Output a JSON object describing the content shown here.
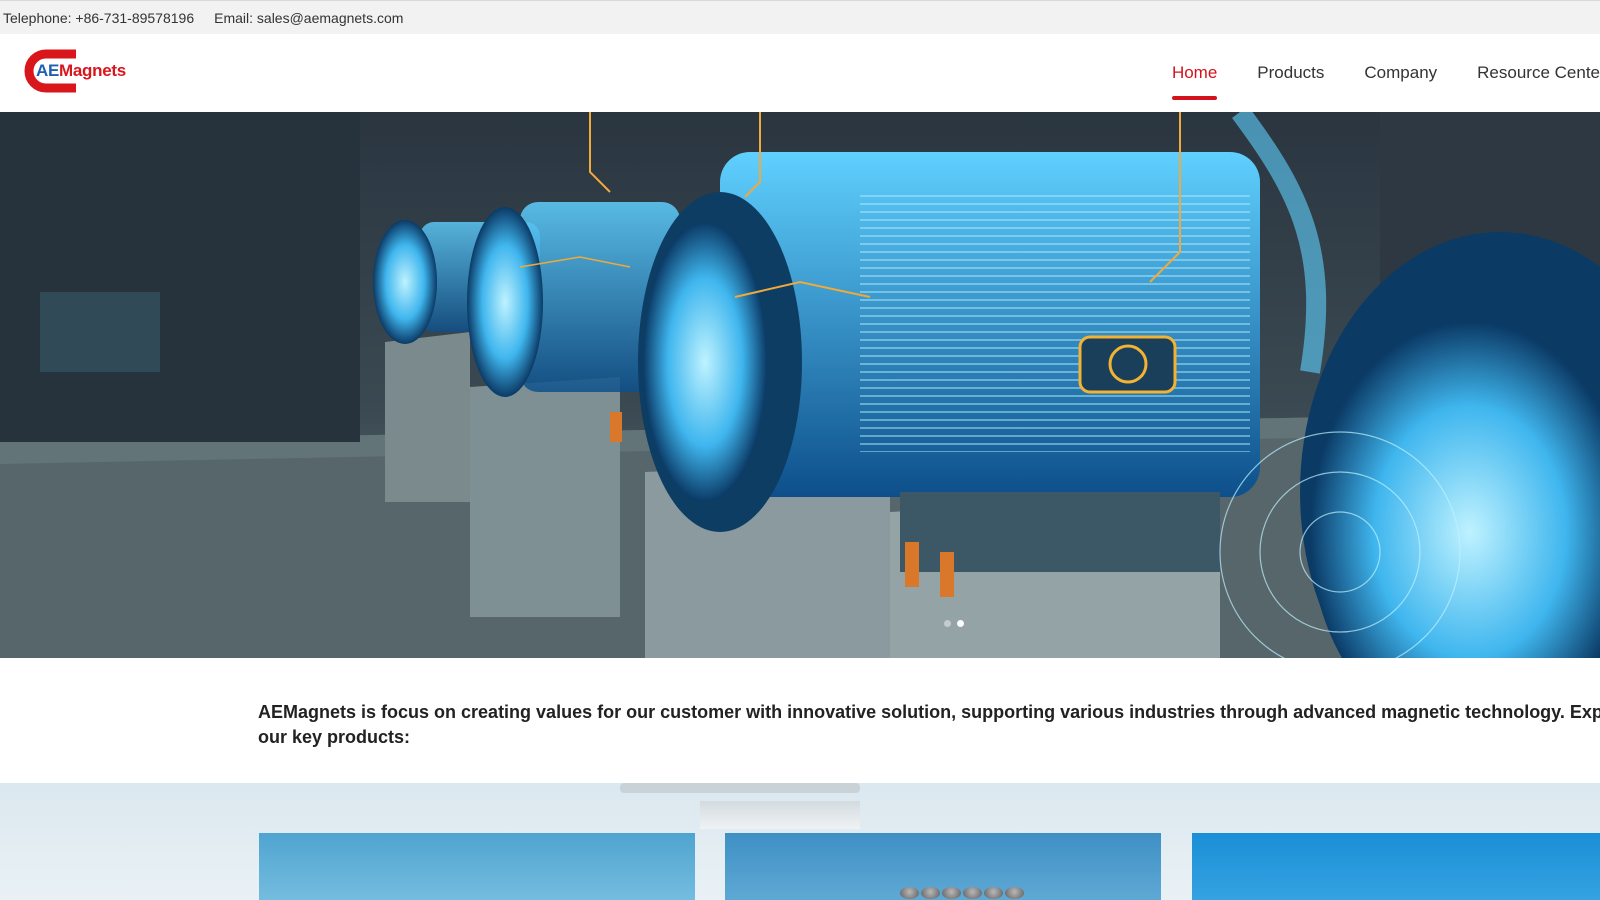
{
  "topbar": {
    "telephone": "Telephone: +86-731-89578196",
    "email": "Email: sales@aemagnets.com"
  },
  "brand": {
    "logo_prefix": "AE",
    "logo_suffix": "Magnets",
    "colors": {
      "red": "#d4121b",
      "blue": "#1f5fb4"
    }
  },
  "nav": {
    "items": [
      {
        "label": "Home",
        "active": true
      },
      {
        "label": "Products"
      },
      {
        "label": "Company"
      },
      {
        "label": "Resource Cente"
      }
    ]
  },
  "hero": {
    "slides": 2,
    "active_slide": 2
  },
  "intro": {
    "line1": "AEMagnets is focus on creating values for our customer with innovative solution, supporting various industries through advanced magnetic technology. Explore",
    "line2": "our key products:"
  }
}
